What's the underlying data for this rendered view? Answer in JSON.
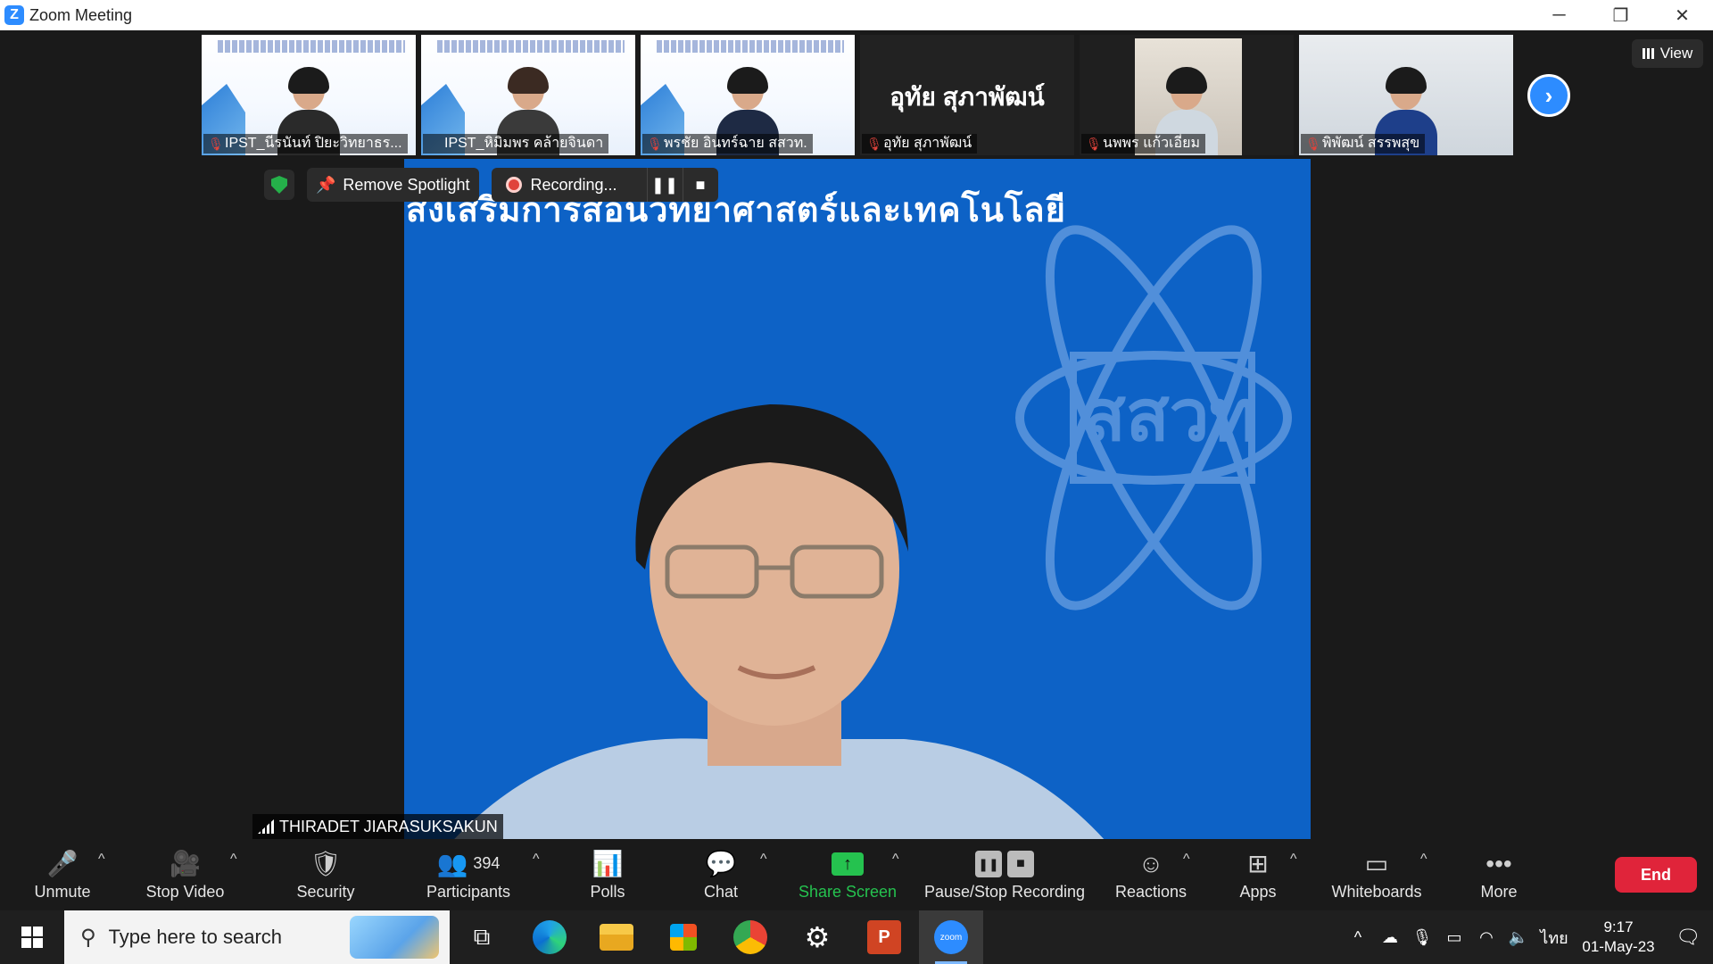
{
  "window": {
    "app_icon_letter": "Z",
    "title": "Zoom Meeting",
    "minimize": "─",
    "restore": "❐",
    "close": "✕"
  },
  "gallery": {
    "tiles": [
      {
        "name": "IPST_นีรนันท์ ปิยะวิทยาธร...",
        "kind": "slide"
      },
      {
        "name": "IPST_หิมิมพร คล้ายจินดา",
        "kind": "slide"
      },
      {
        "name": "พรชัย อินทร์ฉาย สสวท.",
        "kind": "slide"
      },
      {
        "name": "อุทัย สุภาพัฒน์",
        "kind": "black",
        "big_name": "อุทัย สุภาพัฒน์"
      },
      {
        "name": "นพพร แก้วเอี่ยม",
        "kind": "photo"
      },
      {
        "name": "พิพัฒน์ สรรพสุข",
        "kind": "photo2"
      }
    ],
    "next_icon": "›",
    "view_label": "View"
  },
  "overlay": {
    "remove_spotlight": "Remove Spotlight",
    "recording": "Recording...",
    "pause_icon": "❚❚",
    "stop_icon": "■"
  },
  "main_video": {
    "slide_title": "ส่งเสริมการสอนวิทยาศาสตร์และเทคโนโลยี",
    "logo_text": "สสวท",
    "speaker_name": "THIRADET JIARASUKSAKUN"
  },
  "toolbar": {
    "unmute": "Unmute",
    "stop_video": "Stop Video",
    "security": "Security",
    "participants": "Participants",
    "participants_count": "394",
    "polls": "Polls",
    "chat": "Chat",
    "share_screen": "Share Screen",
    "pause_stop_recording": "Pause/Stop Recording",
    "reactions": "Reactions",
    "apps": "Apps",
    "whiteboards": "Whiteboards",
    "more": "More",
    "end": "End",
    "caret": "^"
  },
  "taskbar": {
    "search_placeholder": "Type here to search",
    "language": "ไทย",
    "time": "9:17",
    "date": "01-May-23"
  },
  "colors": {
    "zoom_blue": "#2d8cff",
    "slide_blue": "#0d62c6",
    "end_red": "#e0243a",
    "share_green": "#25c24f",
    "muted_red": "#e0433b"
  }
}
